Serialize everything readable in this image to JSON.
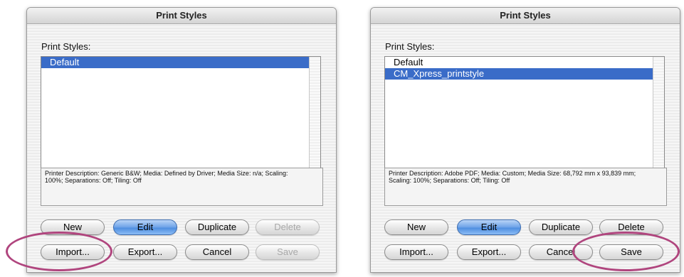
{
  "left_dialog": {
    "title": "Print Styles",
    "list_label": "Print Styles:",
    "items": [
      "Default"
    ],
    "selected_index": 0,
    "description": "Printer Description: Generic B&W;  Media: Defined by Driver;  Media Size: n/a;  Scaling: 100%;  Separations: Off;  Tiling: Off",
    "buttons": {
      "new": "New",
      "edit": "Edit",
      "duplicate": "Duplicate",
      "delete": "Delete",
      "import": "Import...",
      "export": "Export...",
      "cancel": "Cancel",
      "save": "Save"
    },
    "disabled": [
      "delete",
      "save"
    ],
    "highlighted": "import"
  },
  "right_dialog": {
    "title": "Print Styles",
    "list_label": "Print Styles:",
    "items": [
      "Default",
      "CM_Xpress_printstyle"
    ],
    "selected_index": 1,
    "description": "Printer Description: Adobe PDF;  Media: Custom;  Media Size: 68,792 mm x 93,839 mm;  Scaling: 100%;  Separations: Off;  Tiling: Off",
    "buttons": {
      "new": "New",
      "edit": "Edit",
      "duplicate": "Duplicate",
      "delete": "Delete",
      "import": "Import...",
      "export": "Export...",
      "cancel": "Cancel",
      "save": "Save"
    },
    "disabled": [],
    "highlighted": "save"
  },
  "colors": {
    "selection": "#3a6cc8",
    "highlight_ring": "#b0457e",
    "default_button": "#6da3e8"
  }
}
